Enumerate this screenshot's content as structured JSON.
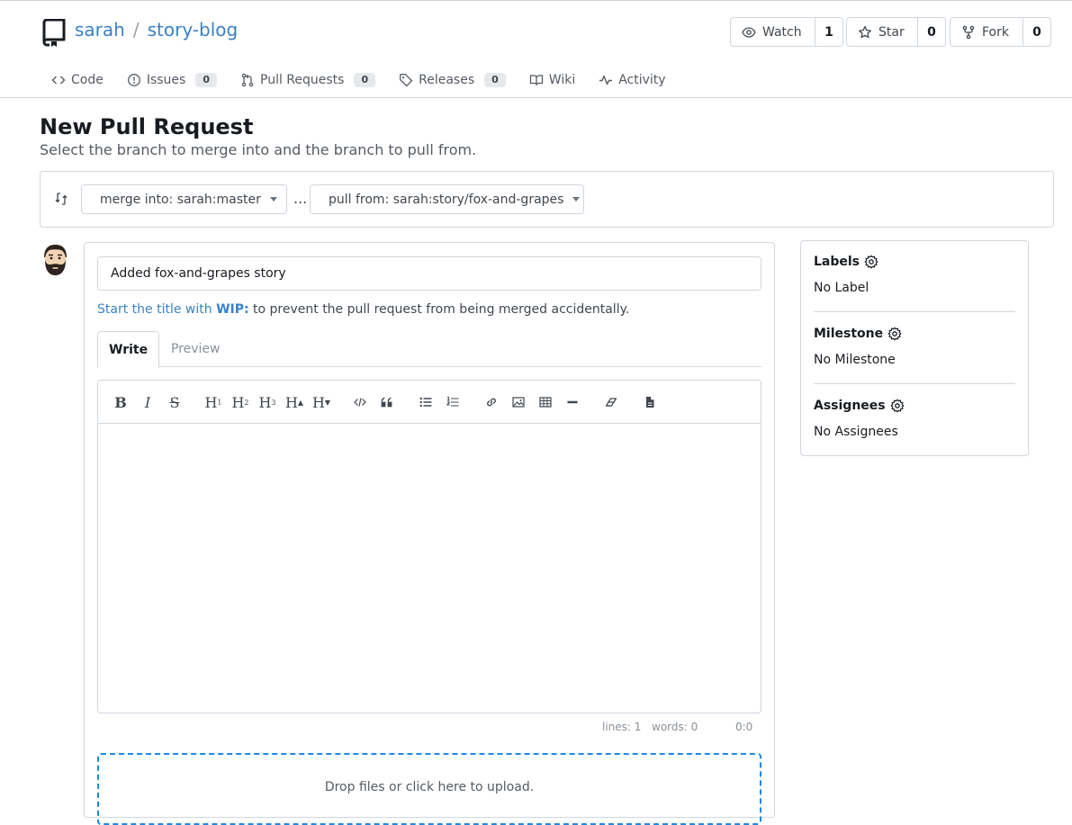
{
  "header": {
    "owner": "sarah",
    "separator": "/",
    "repo": "story-blog",
    "watch": {
      "label": "Watch",
      "count": "1"
    },
    "star": {
      "label": "Star",
      "count": "0"
    },
    "fork": {
      "label": "Fork",
      "count": "0"
    }
  },
  "tabs": [
    {
      "label": "Code"
    },
    {
      "label": "Issues",
      "count": "0"
    },
    {
      "label": "Pull Requests",
      "count": "0"
    },
    {
      "label": "Releases",
      "count": "0"
    },
    {
      "label": "Wiki"
    },
    {
      "label": "Activity"
    }
  ],
  "page": {
    "title": "New Pull Request",
    "subtitle": "Select the branch to merge into and the branch to pull from."
  },
  "branches": {
    "merge_into": "merge into: sarah:master",
    "ellipsis": "...",
    "pull_from": "pull from: sarah:story/fox-and-grapes"
  },
  "form": {
    "title_value": "Added fox-and-grapes story",
    "hint_prefix": "Start the title with",
    "hint_wip": "WIP:",
    "hint_suffix": "to prevent the pull request from being merged accidentally.",
    "tab_write": "Write",
    "tab_preview": "Preview",
    "status_lines": "lines: 1",
    "status_words": "words: 0",
    "status_cursor": "0:0",
    "dropzone": "Drop files or click here to upload."
  },
  "sidebar": {
    "labels": {
      "title": "Labels",
      "value": "No Label"
    },
    "milestone": {
      "title": "Milestone",
      "value": "No Milestone"
    },
    "assignees": {
      "title": "Assignees",
      "value": "No Assignees"
    }
  },
  "colors": {
    "link": "#3a82c5",
    "border": "#d0d7de",
    "dropzone": "#1e88e5"
  }
}
